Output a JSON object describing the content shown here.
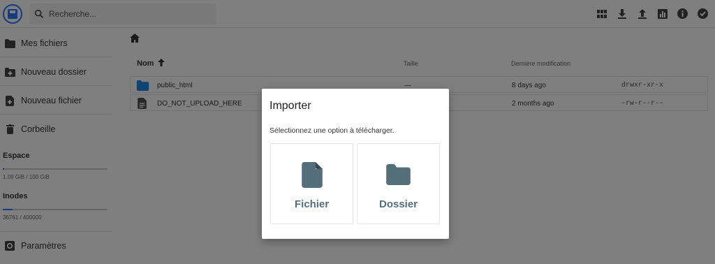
{
  "header": {
    "search_placeholder": "Recherche..."
  },
  "sidebar": {
    "items": [
      {
        "label": "Mes fichiers",
        "icon": "folder-icon"
      },
      {
        "label": "Nouveau dossier",
        "icon": "create-folder-icon"
      },
      {
        "label": "Nouveau fichier",
        "icon": "new-file-icon"
      },
      {
        "label": "Corbeille",
        "icon": "trash-icon"
      }
    ],
    "space": {
      "title": "Espace",
      "value": "1.09 GiB / 100 GiB",
      "fraction": 0.011
    },
    "inodes": {
      "title": "Inodes",
      "value": "36761 / 400000",
      "fraction": 0.092
    },
    "settings_label": "Paramètres"
  },
  "table": {
    "headers": {
      "name": "Nom",
      "size": "Taille",
      "modified": "Dernière modification"
    },
    "rows": [
      {
        "name": "public_html",
        "size": "—",
        "modified": "8 days ago",
        "perms": "drwxr-xr-x",
        "icon": "folder-icon"
      },
      {
        "name": "DO_NOT_UPLOAD_HERE",
        "size": "",
        "modified": "2 months ago",
        "perms": "-rw-r--r--",
        "icon": "file-icon"
      }
    ]
  },
  "modal": {
    "title": "Importer",
    "description": "Sélectionnez une option à télécharger.",
    "options": [
      {
        "label": "Fichier",
        "icon": "file-icon"
      },
      {
        "label": "Dossier",
        "icon": "folder-icon"
      }
    ]
  },
  "colors": {
    "accent": "#2979ff",
    "folder": "#1e88e5",
    "option_icon": "#546e7a"
  }
}
